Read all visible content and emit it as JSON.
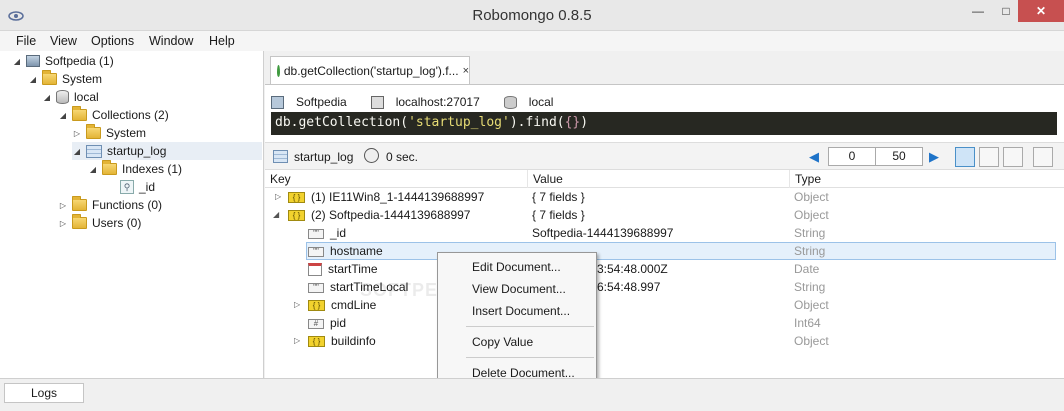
{
  "window": {
    "title": "Robomongo 0.8.5",
    "min_icon": "minimize-icon",
    "max_icon": "maximize-icon",
    "close_icon": "close-icon"
  },
  "menu": [
    "File",
    "View",
    "Options",
    "Window",
    "Help"
  ],
  "tree": {
    "server": "Softpedia (1)",
    "system": "System",
    "db": "local",
    "collections": "Collections (2)",
    "coll_system": "System",
    "coll_startup": "startup_log",
    "indexes": "Indexes (1)",
    "index_id": "_id",
    "functions": "Functions (0)",
    "users": "Users (0)"
  },
  "tab": {
    "label": "db.getCollection('startup_log').f...",
    "close": "×"
  },
  "info": {
    "server": "Softpedia",
    "host": "localhost:27017",
    "db": "local"
  },
  "query": {
    "prefix": "db.getCollection(",
    "string": "'startup_log'",
    "mid": ").find(",
    "braces": "{}",
    "suffix": ")"
  },
  "result_bar": {
    "collection": "startup_log",
    "time": "0 sec.",
    "skip": "0",
    "limit": "50"
  },
  "columns": {
    "key": "Key",
    "value": "Value",
    "type": "Type"
  },
  "rows": [
    {
      "key": "(1) IE11Win8_1-1444139688997",
      "value": "{ 7 fields }",
      "type": "Object"
    },
    {
      "key": "(2) Softpedia-1444139688997",
      "value": "{ 7 fields }",
      "type": "Object"
    },
    {
      "key": "_id",
      "value": "Softpedia-1444139688997",
      "type": "String"
    },
    {
      "key": "hostname",
      "value": "",
      "type": "String"
    },
    {
      "key": "startTime",
      "value": "3:54:48.000Z",
      "type": "Date"
    },
    {
      "key": "startTimeLocal",
      "value": "6:54:48.997",
      "type": "String"
    },
    {
      "key": "cmdLine",
      "value": "",
      "type": "Object"
    },
    {
      "key": "pid",
      "value": "",
      "type": "Int64"
    },
    {
      "key": "buildinfo",
      "value": "",
      "type": "Object"
    }
  ],
  "context_menu": {
    "edit": "Edit Document...",
    "view": "View Document...",
    "insert": "Insert Document...",
    "copy": "Copy Value",
    "delete": "Delete Document..."
  },
  "status": {
    "logs": "Logs"
  },
  "watermark": "SOFTPEDIA"
}
